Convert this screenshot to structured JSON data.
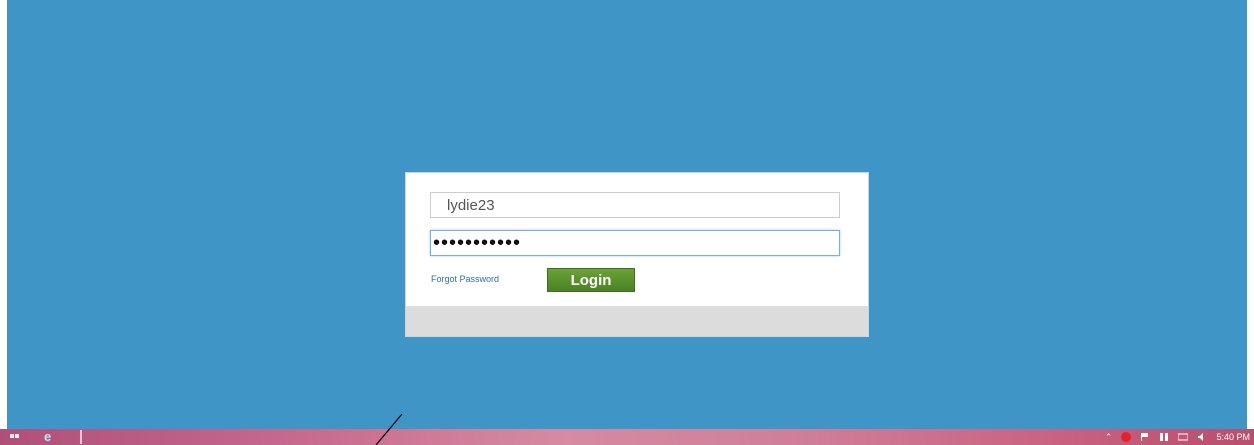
{
  "login": {
    "username_value": "lydie23",
    "password_value": "•••••••••••",
    "forgot_label": "Forgot Password",
    "login_label": "Login"
  },
  "taskbar": {
    "start_icon": "windows-start-icon",
    "pinned": [
      "internet-explorer-icon"
    ],
    "tray": {
      "icons": [
        "show-hidden-icons-chevron",
        "opera-icon",
        "flag-icon",
        "network-icon",
        "keyboard-icon",
        "volume-icon"
      ],
      "chevron": "⌃",
      "clock": "5:40 PM"
    }
  },
  "colors": {
    "desktop_background": "#3f96c6",
    "login_button": "#5a9230",
    "link": "#2b6fa3"
  }
}
